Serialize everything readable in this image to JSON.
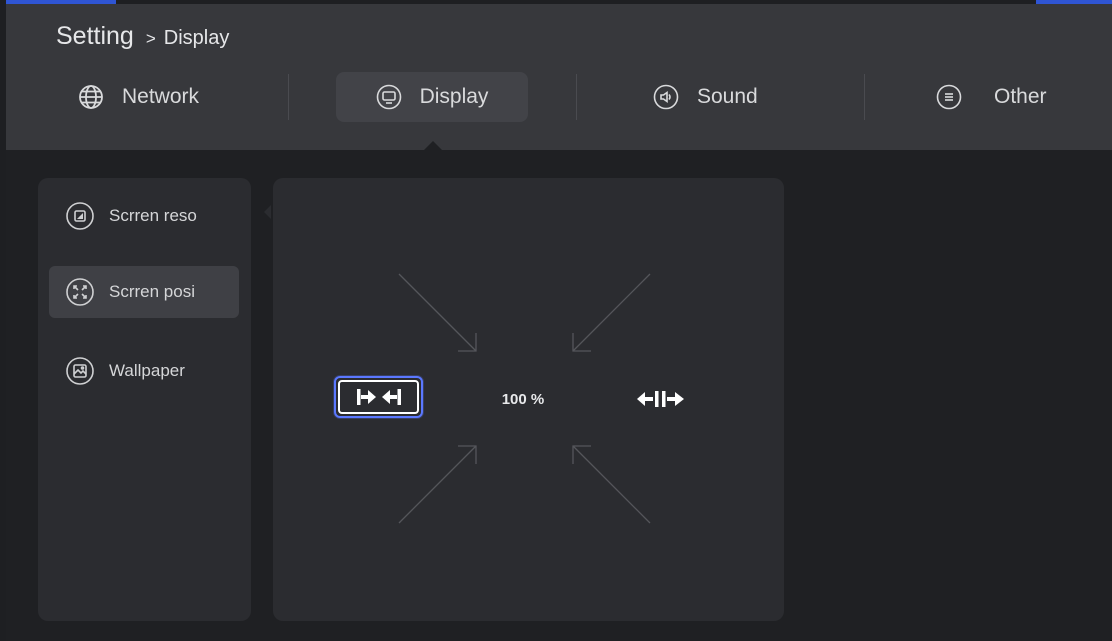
{
  "breadcrumb": {
    "root": "Setting",
    "separator": ">",
    "current": "Display"
  },
  "tabs": [
    {
      "label": "Network",
      "icon": "globe-icon"
    },
    {
      "label": "Display",
      "icon": "monitor-icon",
      "active": true
    },
    {
      "label": "Sound",
      "icon": "speaker-icon"
    },
    {
      "label": "Other",
      "icon": "menu-lines-icon"
    }
  ],
  "sidebar": {
    "items": [
      {
        "label": "Scrren reso",
        "icon": "resolution-icon"
      },
      {
        "label": "Scrren posi",
        "icon": "position-icon",
        "active": true
      },
      {
        "label": "Wallpaper",
        "icon": "wallpaper-icon"
      }
    ]
  },
  "position_panel": {
    "zoom": "100 %",
    "shrink_icon": "shrink-arrows-icon",
    "expand_icon": "expand-arrows-icon"
  },
  "colors": {
    "accent": "#2f55d4",
    "focus_border": "#5b78ff",
    "header_bg": "#37383c",
    "panel_bg": "#2b2c30",
    "page_bg": "#1f2023"
  }
}
